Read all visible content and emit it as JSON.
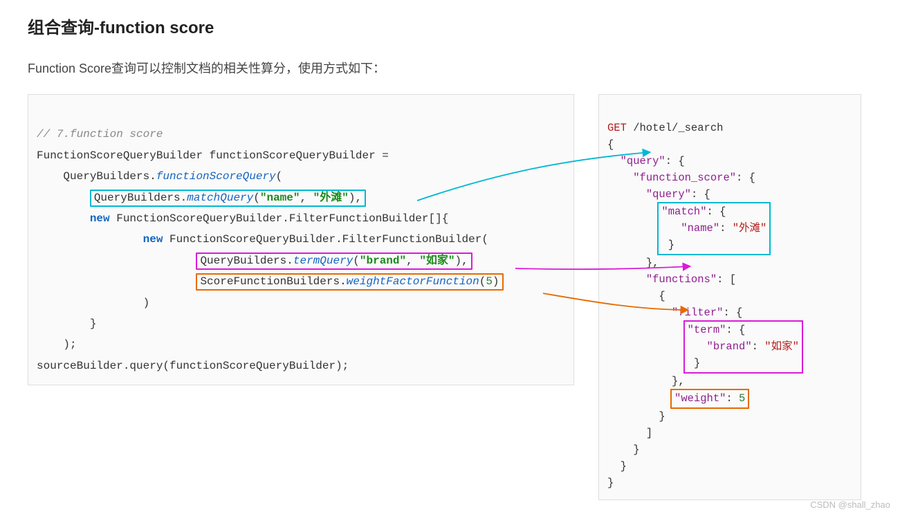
{
  "title": "组合查询-function score",
  "description": "Function Score查询可以控制文档的相关性算分，使用方式如下：",
  "java": {
    "comment": "// 7.function score",
    "l1": "FunctionScoreQueryBuilder functionScoreQueryBuilder =",
    "l2a": "QueryBuilders.",
    "l2b": "functionScoreQuery",
    "l2c": "(",
    "box1_a": "QueryBuilders.",
    "box1_b": "matchQuery",
    "box1_c": "(",
    "box1_d": "\"name\"",
    "box1_e": ", ",
    "box1_f": "\"外滩\"",
    "box1_g": "),",
    "l4a": "new",
    "l4b": " FunctionScoreQueryBuilder.FilterFunctionBuilder[]{",
    "l5a": "new",
    "l5b": " FunctionScoreQueryBuilder.FilterFunctionBuilder(",
    "box2_a": "QueryBuilders.",
    "box2_b": "termQuery",
    "box2_c": "(",
    "box2_d": "\"brand\"",
    "box2_e": ", ",
    "box2_f": "\"如家\"",
    "box2_g": "),",
    "box3_a": "ScoreFunctionBuilders.",
    "box3_b": "weightFactorFunction",
    "box3_c": "(",
    "box3_d": "5",
    "box3_e": ")",
    "l8": ")",
    "l9": "}",
    "l10": ");",
    "l11": "sourceBuilder.query(functionScoreQueryBuilder);"
  },
  "dsl": {
    "l1a": "GET",
    "l1b": " /hotel/_search",
    "l2": "{",
    "l3a": "\"query\"",
    "l3b": ": {",
    "l4a": "\"function_score\"",
    "l4b": ": {",
    "l5a": "\"query\"",
    "l5b": ": {",
    "bx1_1a": "\"match\"",
    "bx1_1b": ": {",
    "bx1_2a": "\"name\"",
    "bx1_2b": ": ",
    "bx1_2c": "\"外滩\"",
    "bx1_3": "}",
    "l9": "},",
    "l10a": "\"functions\"",
    "l10b": ": [",
    "l11": "{",
    "l12a": "\"filter\"",
    "l12b": ": {",
    "bx2_1a": "\"term\"",
    "bx2_1b": ": {",
    "bx2_2a": "\"brand\"",
    "bx2_2b": ": ",
    "bx2_2c": "\"如家\"",
    "bx2_3": "}",
    "l16": "},",
    "bx3_a": "\"weight\"",
    "bx3_b": ": ",
    "bx3_c": "5",
    "l18": "}",
    "l19": "]",
    "l20": "}",
    "l21": "}",
    "l22": "}"
  },
  "watermark": "CSDN @shall_zhao",
  "colors": {
    "cyan": "#00b8d4",
    "magenta": "#d81bd8",
    "orange": "#e66a00"
  }
}
